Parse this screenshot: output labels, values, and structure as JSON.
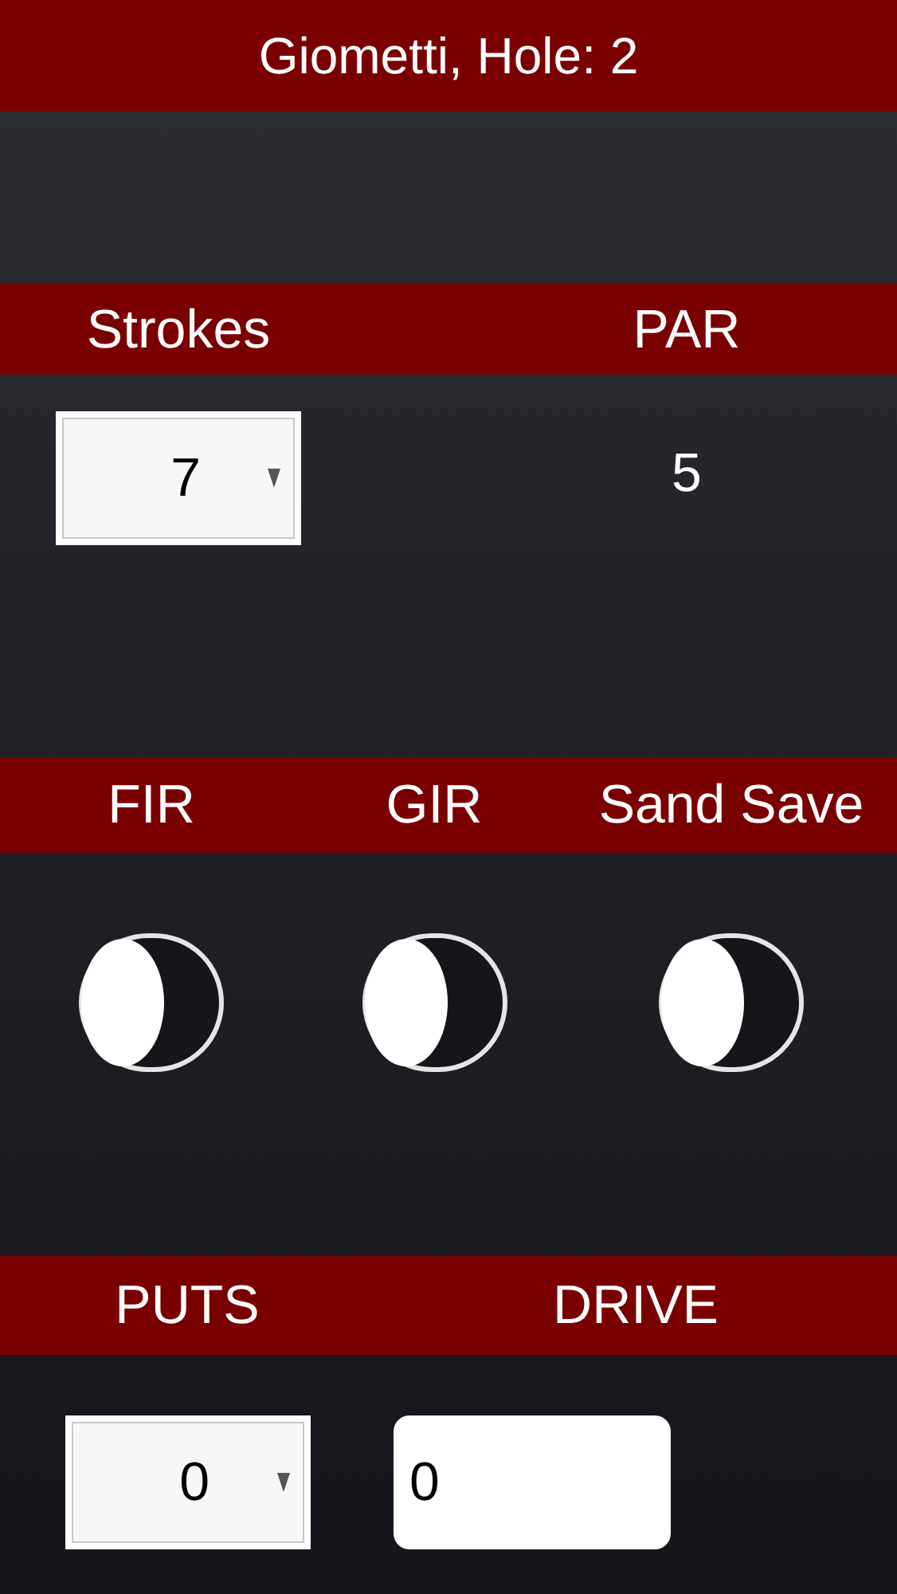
{
  "header": {
    "title": "Giometti, Hole: 2"
  },
  "sections": [
    {
      "fields": [
        {
          "label": "Strokes",
          "kind": "select",
          "value": "7"
        },
        {
          "label": "PAR",
          "kind": "text",
          "value": "5"
        }
      ]
    },
    {
      "fields": [
        {
          "label": "FIR",
          "kind": "toggle",
          "on": false
        },
        {
          "label": "GIR",
          "kind": "toggle",
          "on": false
        },
        {
          "label": "Sand Save",
          "kind": "toggle",
          "on": false
        }
      ]
    },
    {
      "fields": [
        {
          "label": "PUTS",
          "kind": "select",
          "value": "0"
        },
        {
          "label": "DRIVE",
          "kind": "input",
          "value": "0"
        }
      ]
    }
  ]
}
